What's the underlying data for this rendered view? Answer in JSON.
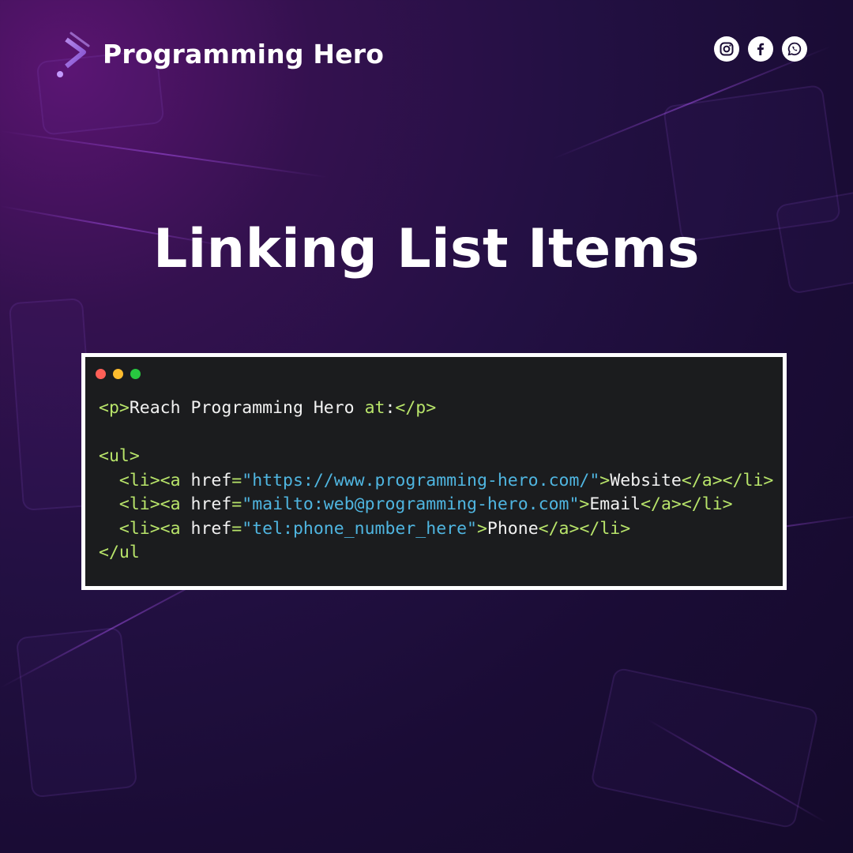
{
  "brand": {
    "name": "Programming Hero",
    "logo_icon": "programming-hero-logo-icon"
  },
  "social": [
    {
      "name": "instagram-icon"
    },
    {
      "name": "facebook-icon"
    },
    {
      "name": "whatsapp-icon"
    }
  ],
  "title": "Linking List Items",
  "code_window": {
    "dots": [
      "#ff5f57",
      "#febc2e",
      "#28c840"
    ],
    "lines": {
      "p_open": "<p>",
      "p_text": "Reach Programming Hero ",
      "p_at": "at",
      "p_colon": ":",
      "p_close": "</p>",
      "ul_open": "<ul>",
      "li1_text": "Website",
      "li1_href": "\"https://www.programming-hero.com/\"",
      "li2_text": "Email",
      "li2_href": "\"mailto:web@programming-hero.com\"",
      "li3_text": "Phone",
      "li3_href": "\"tel:phone_number_here\"",
      "li_open": "<li>",
      "li_close": "</li>",
      "a_open": "<a",
      "a_close": "</a>",
      "href_attr": " href",
      "equals": "=",
      "gt": ">",
      "ul_close": "</ul"
    }
  },
  "colors": {
    "tag": "#b8e46a",
    "string": "#4fb5e0",
    "text": "#f2f2f2",
    "code_bg": "#1b1c1e"
  }
}
